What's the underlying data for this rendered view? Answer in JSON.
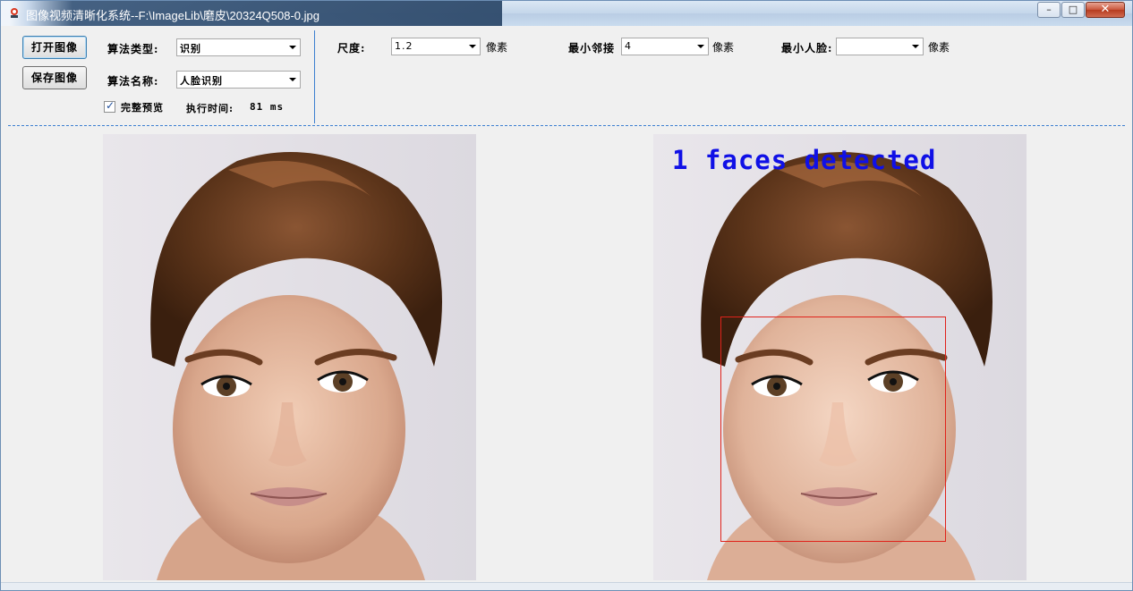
{
  "window": {
    "title": "图像视频清晰化系统--F:\\ImageLib\\磨皮\\20324Q508-0.jpg",
    "controls": {
      "minimize": "–",
      "maximize": "□",
      "close": "✕"
    }
  },
  "toolbar": {
    "open_label": "打开图像",
    "save_label": "保存图像",
    "algo_type_label": "算法类型:",
    "algo_type_value": "识别",
    "algo_name_label": "算法名称:",
    "algo_name_value": "人脸识别",
    "preview_label": "完整预览",
    "preview_checked": true,
    "exec_time_label": "执行时间:",
    "exec_time_value": "81 ms"
  },
  "params": {
    "scale_label": "尺度:",
    "scale_value": "1.2",
    "scale_unit": "像素",
    "min_neighbors_label": "最小邻接",
    "min_neighbors_value": "4",
    "min_neighbors_unit": "像素",
    "min_face_label": "最小人脸:",
    "min_face_value": "",
    "min_face_unit": "像素"
  },
  "images": {
    "result_overlay": "1 faces detected",
    "detection_box_color": "#e0231b",
    "overlay_color": "#1010e6"
  }
}
